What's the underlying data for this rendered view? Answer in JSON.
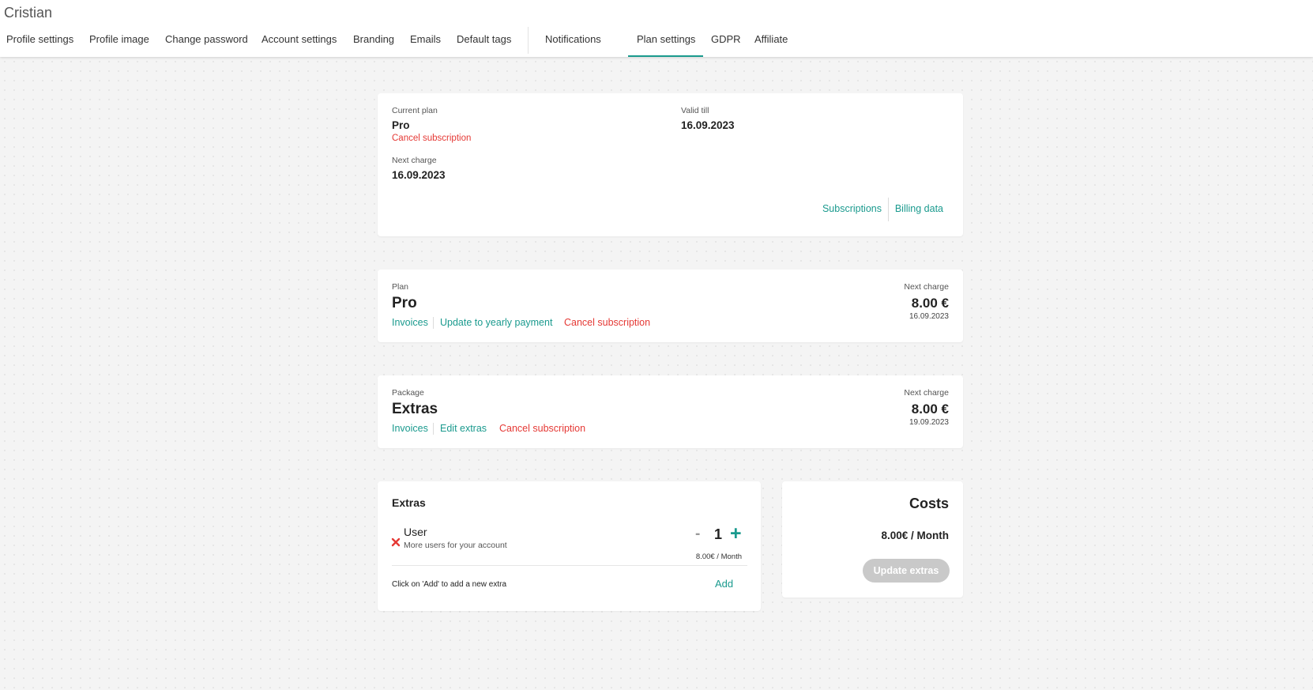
{
  "header": {
    "user_name": "Cristian",
    "tabs": [
      {
        "label": "Profile settings"
      },
      {
        "label": "Profile image"
      },
      {
        "label": "Change password"
      },
      {
        "label": "Account settings"
      },
      {
        "label": "Branding"
      },
      {
        "label": "Emails"
      },
      {
        "label": "Default tags"
      },
      {
        "label": "Notifications"
      },
      {
        "label": "Plan settings",
        "active": true
      },
      {
        "label": "GDPR"
      },
      {
        "label": "Affiliate"
      }
    ]
  },
  "summary": {
    "current_plan_label": "Current plan",
    "current_plan": "Pro",
    "cancel_label": "Cancel subscription",
    "valid_till_label": "Valid till",
    "valid_till": "16.09.2023",
    "next_charge_label": "Next charge",
    "next_charge": "16.09.2023",
    "subscriptions_link": "Subscriptions",
    "billing_link": "Billing data"
  },
  "plan": {
    "label": "Plan",
    "name": "Pro",
    "invoices_link": "Invoices",
    "yearly_link": "Update to yearly payment",
    "cancel_link": "Cancel subscription",
    "next_charge_label": "Next charge",
    "price": "8.00 €",
    "date": "16.09.2023"
  },
  "package": {
    "label": "Package",
    "name": "Extras",
    "invoices_link": "Invoices",
    "edit_link": "Edit extras",
    "cancel_link": "Cancel subscription",
    "next_charge_label": "Next charge",
    "price": "8.00 €",
    "date": "19.09.2023"
  },
  "extras": {
    "title": "Extras",
    "item_name": "User",
    "item_desc": "More users for your account",
    "quantity": "1",
    "minus": "-",
    "plus": "+",
    "item_price": "8.00€ / Month",
    "hint": "Click on 'Add' to add a new extra",
    "add_label": "Add"
  },
  "costs": {
    "title": "Costs",
    "amount": "8.00€ / Month",
    "update_button": "Update extras"
  },
  "colors": {
    "accent": "#1a9a8e",
    "danger": "#e53935",
    "disabled": "#c9c9c9"
  }
}
